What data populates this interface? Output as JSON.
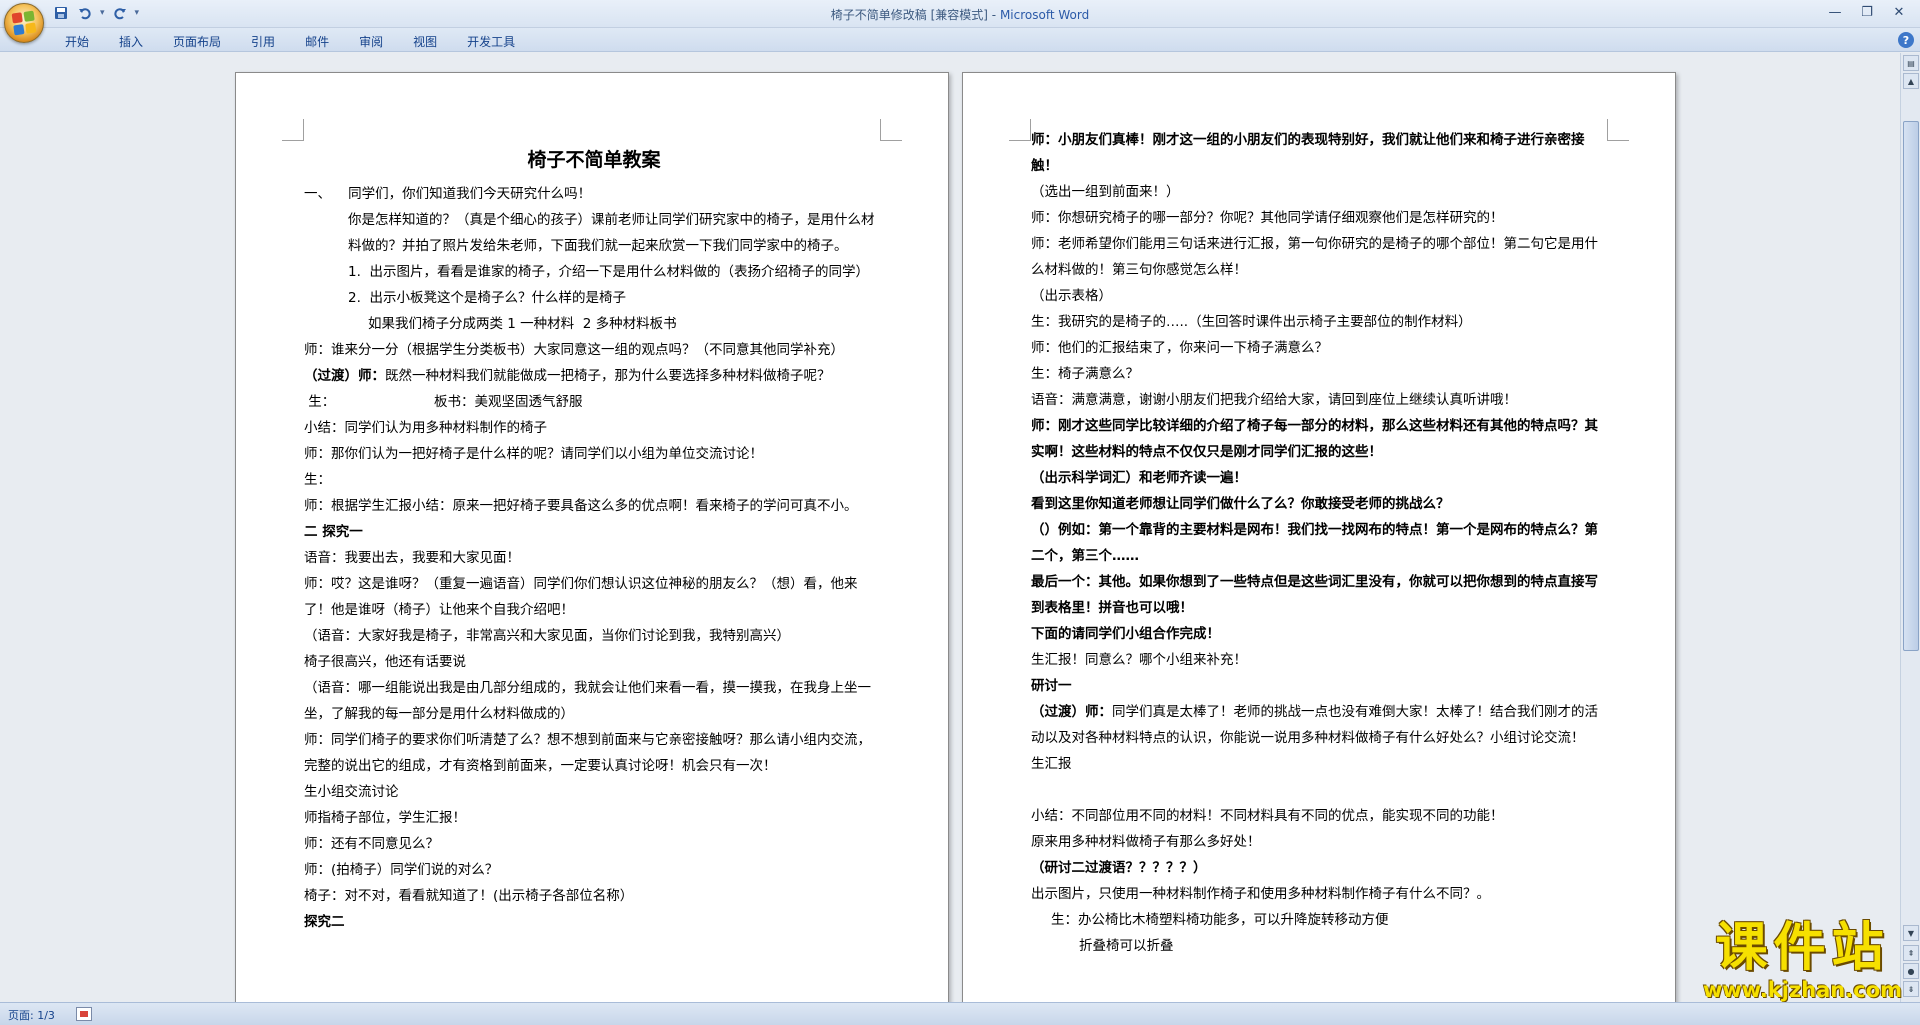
{
  "window": {
    "title": "椅子不简单修改稿 [兼容模式]",
    "title_sep": " - ",
    "app_name": "Microsoft Word"
  },
  "qat": {
    "save": "save-icon",
    "undo": "undo-icon",
    "redo": "redo-icon",
    "more": "▾"
  },
  "ribbon": {
    "tabs": [
      "开始",
      "插入",
      "页面布局",
      "引用",
      "邮件",
      "审阅",
      "视图",
      "开发工具"
    ]
  },
  "status": {
    "page": "页面: 1/3"
  },
  "watermark": {
    "text": "课件站",
    "url": "www.kjzhan.com"
  },
  "page1": {
    "title": "椅子不简单教案",
    "lines": [
      {
        "t": "一、    同学们，你们知道我们今天研究什么吗！",
        "c": "hang"
      },
      {
        "t": "你是怎样知道的？（真是个细心的孩子）课前老师让同学们研究家中的椅子，是用什么材料做的？并拍了照片发给朱老师，下面我们就一起来欣赏一下我们同学家中的椅子。",
        "c": "ind1"
      },
      {
        "t": "1.  出示图片，看看是谁家的椅子，介绍一下是用什么材料做的（表扬介绍椅子的同学）",
        "c": "ind2"
      },
      {
        "t": "2.  出示小板凳这个是椅子么？什么样的是椅子",
        "c": "ind2"
      },
      {
        "t": "如果我们椅子分成两类 1 一种材料  2 多种材料板书",
        "c": "ind3"
      },
      {
        "t": "师：谁来分一分（根据学生分类板书）大家同意这一组的观点吗？（不同意其他同学补充）",
        "c": "ind4 hangsmall"
      },
      {
        "t": "（过渡）师：既然一种材料我们就能做成一把椅子，那为什么要选择多种材料做椅子呢？",
        "c": "pb"
      },
      {
        "t": " 生：                       板书：美观坚固透气舒服",
        "c": ""
      },
      {
        "t": "小结：同学们认为用多种材料制作的椅子",
        "c": ""
      },
      {
        "t": "师：那你们认为一把好椅子是什么样的呢？请同学们以小组为单位交流讨论！",
        "c": ""
      },
      {
        "t": "生：",
        "c": ""
      },
      {
        "t": "师：根据学生汇报小结：原来一把好椅子要具备这么多的优点啊！看来椅子的学问可真不小。",
        "c": ""
      },
      {
        "t": "二 探究一",
        "c": "b"
      },
      {
        "t": "语音：我要出去，我要和大家见面！",
        "c": ""
      },
      {
        "t": "师：哎？这是谁呀？（重复一遍语音）同学们你们想认识这位神秘的朋友么？（想）看，他来了！他是谁呀（椅子）让他来个自我介绍吧！",
        "c": ""
      },
      {
        "t": "（语音：大家好我是椅子，非常高兴和大家见面，当你们讨论到我，我特别高兴）",
        "c": ""
      },
      {
        "t": "椅子很高兴，他还有话要说",
        "c": ""
      },
      {
        "t": "（语音：哪一组能说出我是由几部分组成的，我就会让他们来看一看，摸一摸我，在我身上坐一坐，了解我的每一部分是用什么材料做成的）",
        "c": ""
      },
      {
        "t": "师：同学们椅子的要求你们听清楚了么？想不想到前面来与它亲密接触呀？那么请小组内交流，完整的说出它的组成，才有资格到前面来，一定要认真讨论呀！机会只有一次！",
        "c": ""
      },
      {
        "t": "生小组交流讨论",
        "c": ""
      },
      {
        "t": "师指椅子部位，学生汇报！",
        "c": ""
      },
      {
        "t": "师：还有不同意见么？",
        "c": ""
      },
      {
        "t": "师：(拍椅子）同学们说的对么？",
        "c": ""
      },
      {
        "t": "椅子：对不对，看看就知道了！(出示椅子各部位名称）",
        "c": ""
      },
      {
        "t": "探究二",
        "c": "b"
      }
    ]
  },
  "page2": {
    "lines": [
      {
        "t": "师：小朋友们真棒！刚才这一组的小朋友们的表现特别好，我们就让他们来和椅子进行亲密接触！",
        "c": "b"
      },
      {
        "t": "（选出一组到前面来！）",
        "c": ""
      },
      {
        "t": "师：你想研究椅子的哪一部分？你呢？其他同学请仔细观察他们是怎样研究的！",
        "c": ""
      },
      {
        "t": "师：老师希望你们能用三句话来进行汇报，第一句你研究的是椅子的哪个部位！第二句它是用什么材料做的！第三句你感觉怎么样！",
        "c": ""
      },
      {
        "t": "（出示表格）",
        "c": ""
      },
      {
        "t": "生：我研究的是椅子的…..（生回答时课件出示椅子主要部位的制作材料）",
        "c": ""
      },
      {
        "t": "师：他们的汇报结束了，你来问一下椅子满意么？",
        "c": ""
      },
      {
        "t": "生：椅子满意么？",
        "c": ""
      },
      {
        "t": "语音：满意满意，谢谢小朋友们把我介绍给大家，请回到座位上继续认真听讲哦！",
        "c": ""
      },
      {
        "t": "师：刚才这些同学比较详细的介绍了椅子每一部分的材料，那么这些材料还有其他的特点吗？其实啊！这些材料的特点不仅仅只是刚才同学们汇报的这些！",
        "c": "b"
      },
      {
        "t": "（出示科学词汇）和老师齐读一遍！",
        "c": "b"
      },
      {
        "t": "看到这里你知道老师想让同学们做什么了么？你敢接受老师的挑战么？",
        "c": "b"
      },
      {
        "t": "（）例如：第一个靠背的主要材料是网布！我们找一找网布的特点！第一个是网布的特点么？第二个，第三个……",
        "c": "b"
      },
      {
        "t": "最后一个：其他。如果你想到了一些特点但是这些词汇里没有，你就可以把你想到的特点直接写到表格里！拼音也可以哦！",
        "c": "b"
      },
      {
        "t": "下面的请同学们小组合作完成！",
        "c": "b"
      },
      {
        "t": "生汇报！同意么？哪个小组来补充！",
        "c": ""
      },
      {
        "t": "研讨一",
        "c": "b"
      },
      {
        "t": "（过渡）师：同学们真是太棒了！老师的挑战一点也没有难倒大家！太棒了！结合我们刚才的活动以及对各种材料特点的认识，你能说一说用多种材料做椅子有什么好处么？小组讨论交流！",
        "c": "pb"
      },
      {
        "t": "生汇报",
        "c": ""
      },
      {
        "t": "",
        "c": ""
      },
      {
        "t": "小结：不同部位用不同的材料！不同材料具有不同的优点，能实现不同的功能！",
        "c": ""
      },
      {
        "t": "原来用多种材料做椅子有那么多好处！",
        "c": ""
      },
      {
        "t": "（研讨二过渡语？？？？？）",
        "c": "b"
      },
      {
        "t": "出示图片，只使用一种材料制作椅子和使用多种材料制作椅子有什么不同？。",
        "c": ""
      },
      {
        "t": "生：办公椅比木椅塑料椅功能多，可以升降旋转移动方便",
        "c": "ind5"
      },
      {
        "t": "折叠椅可以折叠",
        "c": "ind6"
      }
    ]
  }
}
